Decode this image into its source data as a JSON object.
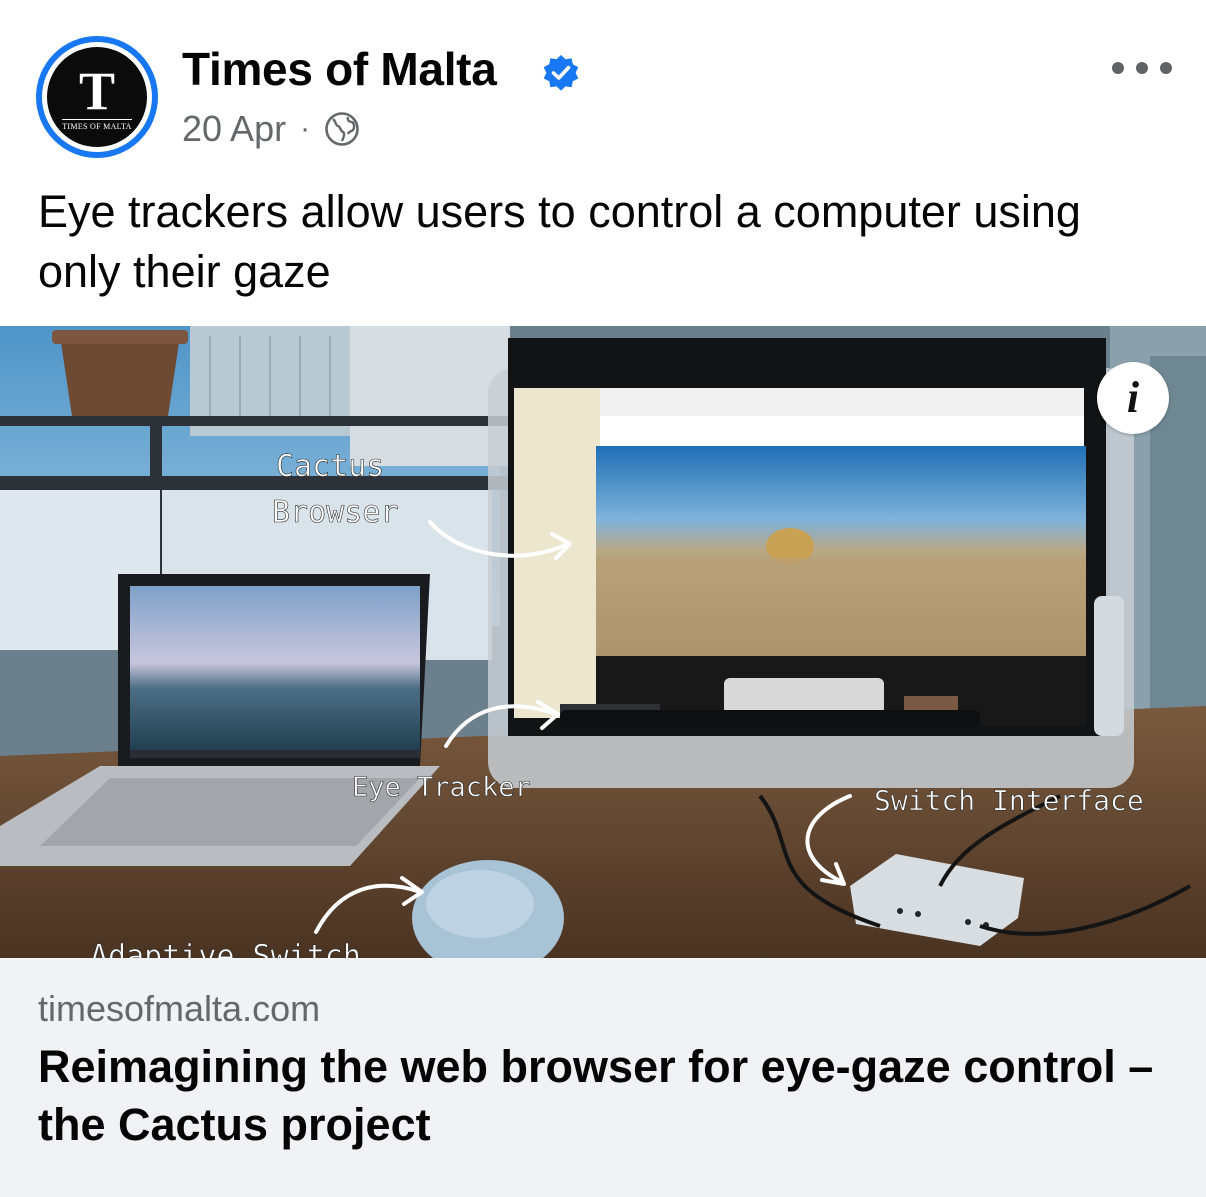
{
  "post": {
    "page_name": "Times of Malta",
    "verified": true,
    "date": "20 Apr",
    "separator": "·",
    "audience_icon": "globe-icon",
    "avatar": {
      "letter": "T",
      "wordmark": "TIMES OF MALTA"
    },
    "caption": "Eye trackers allow users to control a computer using only their gaze"
  },
  "media": {
    "annotations": {
      "cactus_line1": "Cactus",
      "cactus_line2": "Browser",
      "eye_tracker": "Eye Tracker",
      "switch_interface": "Switch Interface",
      "adaptive_switch": "Adaptive Switch"
    },
    "info_icon": "info-icon"
  },
  "link": {
    "domain": "timesofmalta.com",
    "title": "Reimagining the web browser for eye-gaze control – the Cactus project"
  },
  "colors": {
    "accent": "#1877f2",
    "secondary_text": "#65676b",
    "card_bg": "#f0f2f5"
  }
}
